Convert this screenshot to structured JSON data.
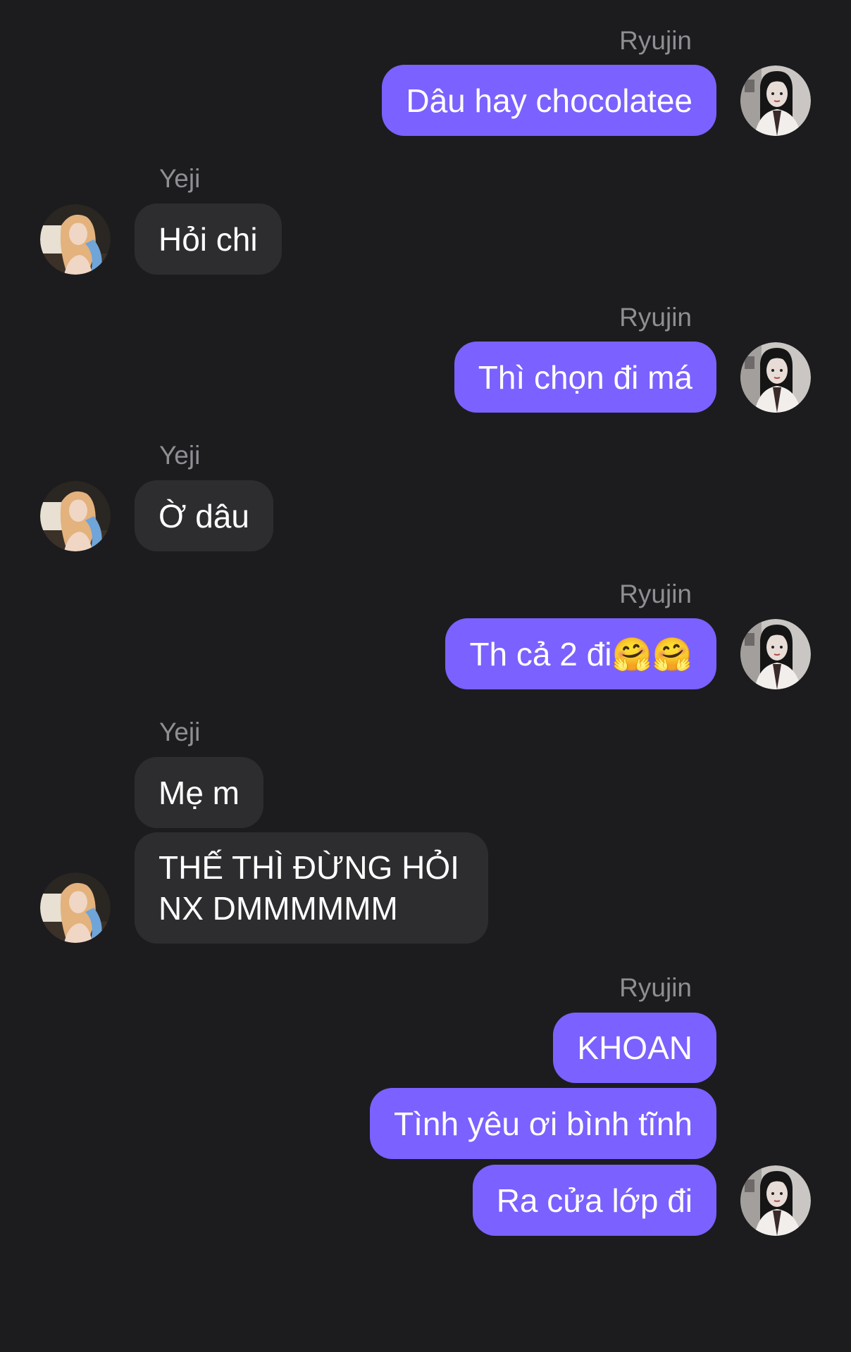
{
  "conversation": {
    "messages": [
      {
        "sender": "Ryujin",
        "text": "Dâu hay chocolatee"
      },
      {
        "sender": "Yeji",
        "text": "Hỏi chi"
      },
      {
        "sender": "Ryujin",
        "text": "Thì chọn đi má"
      },
      {
        "sender": "Yeji",
        "text": "Ờ dâu"
      },
      {
        "sender": "Ryujin",
        "text": "Th cả 2 đi🤗🤗"
      },
      {
        "sender": "Yeji",
        "text": "Mẹ m"
      },
      {
        "sender": "Yeji",
        "text": "THẾ THÌ ĐỪNG HỎI NX DMMMMMM"
      },
      {
        "sender": "Ryujin",
        "text": "KHOAN"
      },
      {
        "sender": "Ryujin",
        "text": "Tình yêu ơi bình tĩnh"
      },
      {
        "sender": "Ryujin",
        "text": "Ra cửa lớp đi"
      }
    ]
  },
  "colors": {
    "background": "#1c1c1e",
    "outgoing_bubble": "#7b61ff",
    "incoming_bubble": "#2d2d2f",
    "sender_label": "#8e8e93"
  },
  "icons": {
    "ryujin_avatar": "ryujin-avatar-icon",
    "yeji_avatar": "yeji-avatar-icon"
  }
}
